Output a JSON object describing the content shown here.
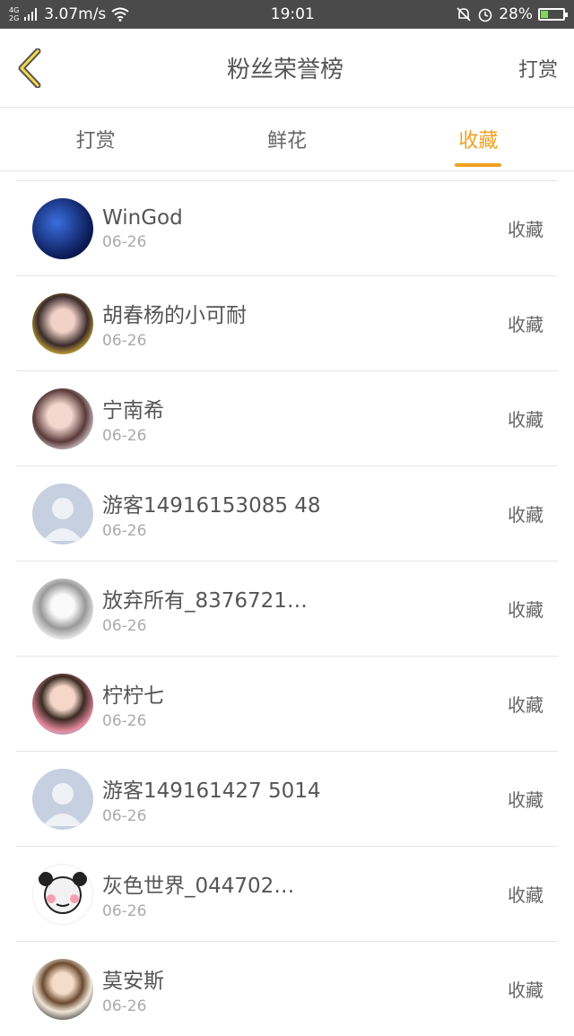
{
  "status": {
    "network_top": "4G",
    "network_bottom": "2G",
    "speed": "3.07m/s",
    "time": "19:01",
    "battery": "28%"
  },
  "header": {
    "title": "粉丝荣誉榜",
    "action": "打赏"
  },
  "tabs": [
    {
      "label": "打赏"
    },
    {
      "label": "鲜花"
    },
    {
      "label": "收藏"
    }
  ],
  "colors": {
    "accent": "#f0a020",
    "statusbar": "#4a4a4a"
  },
  "items": [
    {
      "name": "WinGod",
      "date": "06-26",
      "action": "收藏",
      "avatar": "photo-city"
    },
    {
      "name": "胡春杨的小可耐",
      "date": "06-26",
      "action": "收藏",
      "avatar": "photo-girl"
    },
    {
      "name": "宁南希",
      "date": "06-26",
      "action": "收藏",
      "avatar": "photo-girl"
    },
    {
      "name": "游客14916153085 48",
      "date": "06-26",
      "action": "收藏",
      "avatar": "default-user"
    },
    {
      "name": "放弃所有_8376721…",
      "date": "06-26",
      "action": "收藏",
      "avatar": "sketch-girl"
    },
    {
      "name": "柠柠七",
      "date": "06-26",
      "action": "收藏",
      "avatar": "photo-girl"
    },
    {
      "name": "游客149161427 5014",
      "date": "06-26",
      "action": "收藏",
      "avatar": "default-user"
    },
    {
      "name": "灰色世界_044702…",
      "date": "06-26",
      "action": "收藏",
      "avatar": "meme-face"
    },
    {
      "name": "莫安斯",
      "date": "06-26",
      "action": "收藏",
      "avatar": "photo-boy"
    }
  ]
}
